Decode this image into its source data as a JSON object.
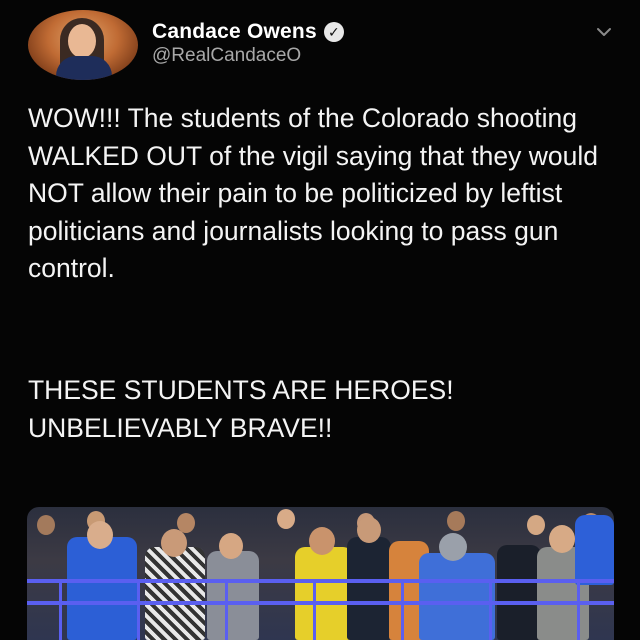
{
  "tweet": {
    "display_name": "Candace Owens",
    "handle": "@RealCandaceO",
    "icons": {
      "avatar": "profile-photo",
      "verified": "verified-badge-icon",
      "menu": "chevron-down-icon"
    },
    "text_paragraph_1": "WOW!!! The students of the Colorado shooting WALKED OUT of the vigil saying that they would NOT allow their pain to be politicized by leftist politicians and journalists looking to pass gun control.",
    "text_paragraph_2": "THESE STUDENTS ARE HEROES! UNBELIEVABLY BRAVE!!",
    "media": "attached-photo"
  },
  "colors": {
    "background": "#050505",
    "text": "#f4f4f4",
    "handle": "#a8a8a8",
    "rail": "#5a5ff0"
  }
}
